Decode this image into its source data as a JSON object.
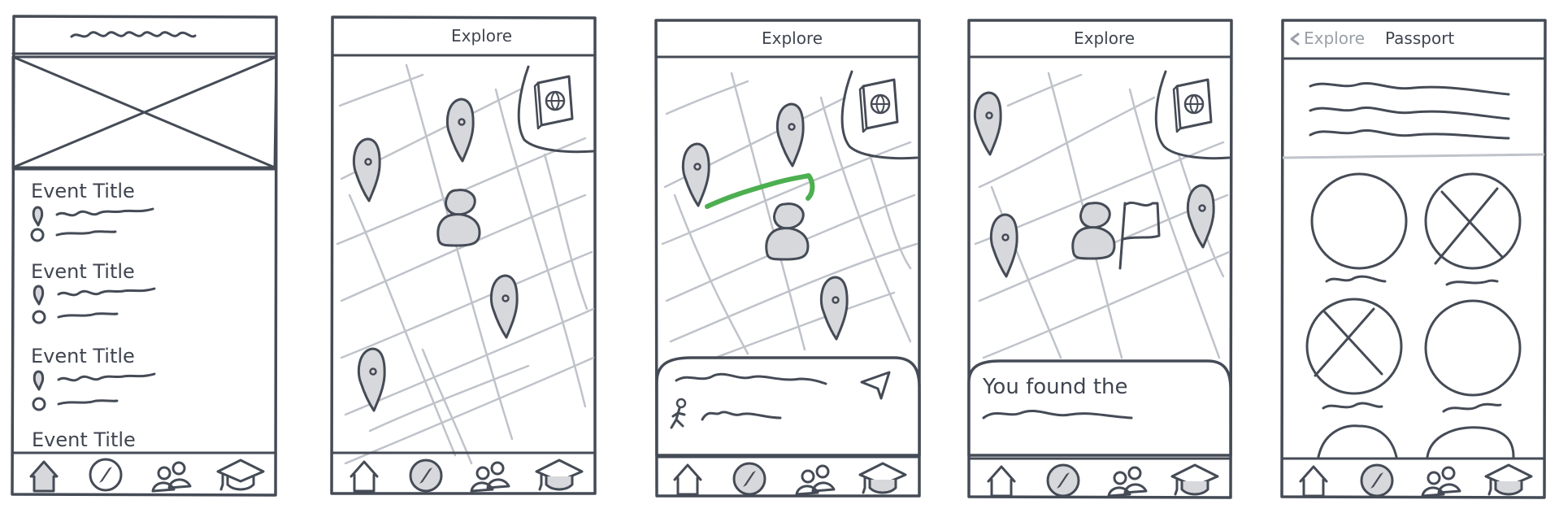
{
  "screens": [
    {
      "id": "event-list",
      "events": [
        "Event Title",
        "Event Title",
        "Event Title",
        "Event Title"
      ]
    },
    {
      "id": "explore-map",
      "header": "Explore"
    },
    {
      "id": "explore-route",
      "header": "Explore"
    },
    {
      "id": "explore-found",
      "header": "Explore",
      "sheet_text": "You found the"
    },
    {
      "id": "passport",
      "back_label": "Explore",
      "header": "Passport"
    }
  ],
  "colors": {
    "ink": "#454b56",
    "grid": "#bfc3ca",
    "fill": "#d6d8dc",
    "route": "#4caf50",
    "muted": "#9aa0a8"
  },
  "nav_icons": [
    "home-icon",
    "compass-icon",
    "people-icon",
    "graduation-cap-icon"
  ],
  "map_icons": [
    "map-pin-icon",
    "person-icon",
    "passport-icon",
    "flag-icon",
    "navigate-arrow-icon",
    "walking-person-icon"
  ]
}
